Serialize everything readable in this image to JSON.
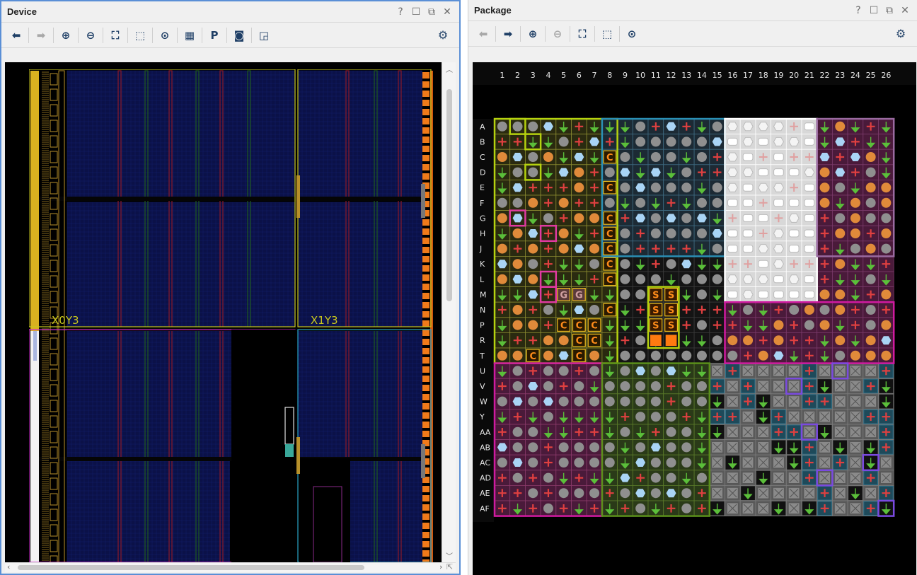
{
  "device": {
    "title": "Device",
    "window_controls": [
      "?",
      "☐",
      "⧉",
      "✕"
    ],
    "toolbar": [
      {
        "icon": "back-arrow-icon",
        "glyph": "⬅",
        "enabled": true
      },
      {
        "icon": "forward-arrow-icon",
        "glyph": "➡",
        "enabled": false
      },
      {
        "icon": "zoom-in-icon",
        "glyph": "⊕",
        "enabled": true
      },
      {
        "icon": "zoom-out-icon",
        "glyph": "⊖",
        "enabled": true
      },
      {
        "icon": "zoom-fit-icon",
        "glyph": "⛶",
        "enabled": true
      },
      {
        "icon": "zoom-selected-icon",
        "glyph": "⬚",
        "enabled": true
      },
      {
        "icon": "autofit-selection-icon",
        "glyph": "⊙",
        "enabled": true
      },
      {
        "icon": "routing-resources-icon",
        "glyph": "▦",
        "enabled": true
      },
      {
        "icon": "create-pblock-icon",
        "glyph": "P",
        "enabled": true
      },
      {
        "icon": "draw-pblock-icon",
        "glyph": "◙",
        "enabled": true
      },
      {
        "icon": "show-region-icon",
        "glyph": "◲",
        "enabled": true
      }
    ],
    "clock_regions": [
      "X0Y3",
      "X1Y3"
    ]
  },
  "package": {
    "title": "Package",
    "window_controls": [
      "?",
      "☐",
      "⧉",
      "✕"
    ],
    "toolbar": [
      {
        "icon": "back-arrow-icon",
        "glyph": "⬅",
        "enabled": false
      },
      {
        "icon": "forward-arrow-icon",
        "glyph": "➡",
        "enabled": true
      },
      {
        "icon": "zoom-in-icon",
        "glyph": "⊕",
        "enabled": true
      },
      {
        "icon": "zoom-out-icon",
        "glyph": "⊖",
        "enabled": false
      },
      {
        "icon": "zoom-fit-icon",
        "glyph": "⛶",
        "enabled": true
      },
      {
        "icon": "zoom-selected-icon",
        "glyph": "⬚",
        "enabled": true
      },
      {
        "icon": "autofit-selection-icon",
        "glyph": "⊙",
        "enabled": true
      }
    ],
    "columns": [
      "1",
      "2",
      "3",
      "4",
      "5",
      "6",
      "7",
      "8",
      "9",
      "10",
      "11",
      "12",
      "13",
      "14",
      "15",
      "16",
      "17",
      "18",
      "19",
      "20",
      "21",
      "22",
      "23",
      "24",
      "25",
      "26"
    ],
    "rows": [
      "A",
      "B",
      "C",
      "D",
      "E",
      "F",
      "G",
      "H",
      "J",
      "K",
      "L",
      "M",
      "N",
      "P",
      "R",
      "T",
      "U",
      "V",
      "W",
      "Y",
      "AA",
      "AB",
      "AC",
      "AD",
      "AE",
      "AF"
    ],
    "pin_labels": {
      "clock": "C",
      "sys": "S",
      "gnd": "G"
    }
  }
}
